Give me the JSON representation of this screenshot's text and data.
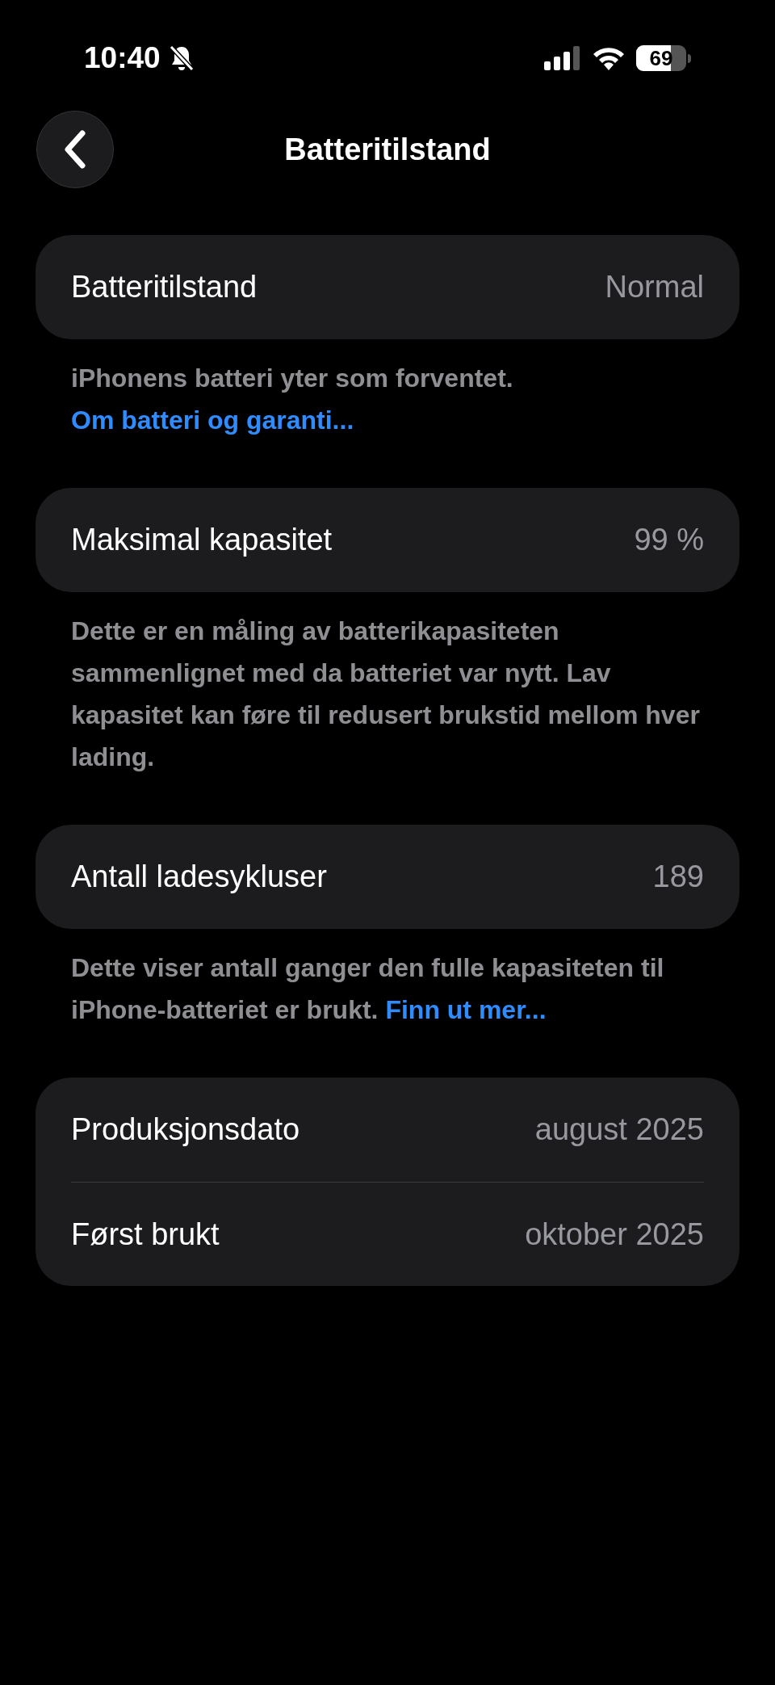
{
  "status_bar": {
    "time": "10:40",
    "silent": true,
    "battery": "69"
  },
  "nav": {
    "title": "Batteritilstand"
  },
  "sections": [
    {
      "rows": [
        {
          "label": "Batteritilstand",
          "value": "Normal"
        }
      ],
      "footer": "iPhonens batteri yter som forventet. ",
      "link": "Om batteri og garanti..."
    },
    {
      "rows": [
        {
          "label": "Maksimal kapasitet",
          "value": "99 %"
        }
      ],
      "footer": "Dette er en måling av batterikapasiteten sammenlignet med da batteriet var nytt. Lav kapasitet kan føre til redusert brukstid mellom hver lading."
    },
    {
      "rows": [
        {
          "label": "Antall ladesykluser",
          "value": "189"
        }
      ],
      "footer": "Dette viser antall ganger den fulle kapasiteten til iPhone-batteriet er brukt. ",
      "link": "Finn ut mer..."
    },
    {
      "rows": [
        {
          "label": "Produksjonsdato",
          "value": "august 2025"
        },
        {
          "label": "Først brukt",
          "value": "oktober 2025"
        }
      ]
    }
  ]
}
